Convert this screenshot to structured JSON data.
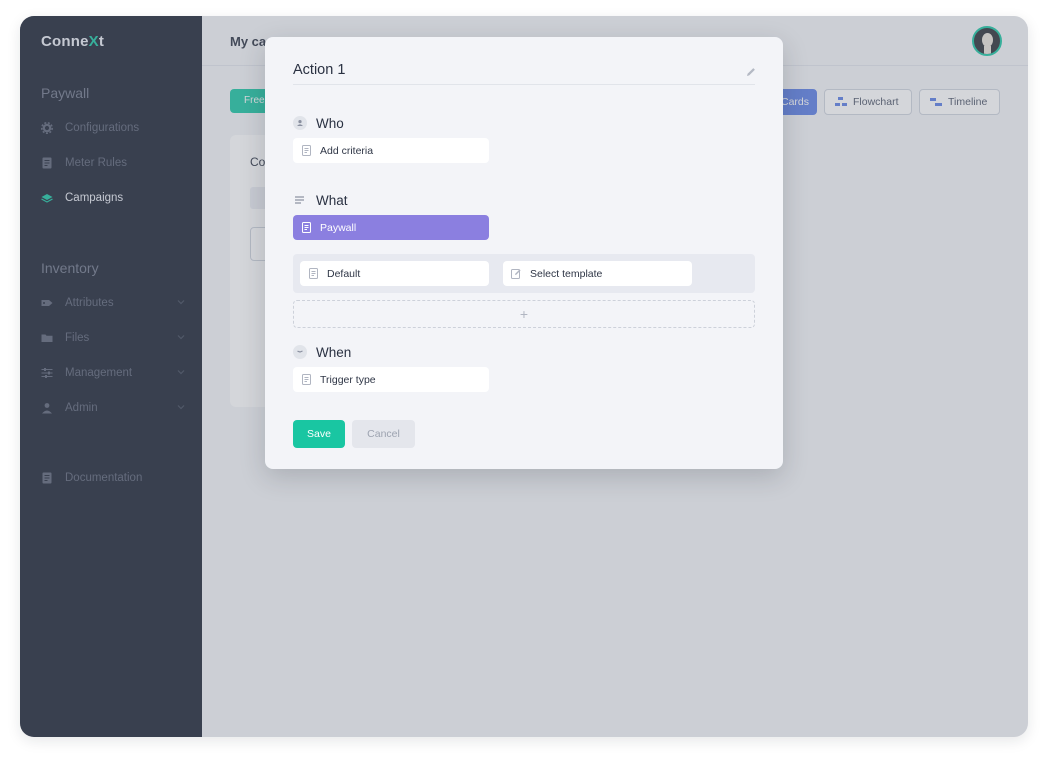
{
  "sidebar": {
    "brand_prefix": "Conne",
    "brand_accent": "X",
    "brand_suffix": "t",
    "sections": [
      {
        "title": "Paywall",
        "items": [
          {
            "label": "Configurations",
            "icon": "gear-icon"
          },
          {
            "label": "Meter Rules",
            "icon": "document-icon"
          },
          {
            "label": "Campaigns",
            "icon": "layers-icon",
            "active": true
          }
        ]
      },
      {
        "title": "Inventory",
        "items": [
          {
            "label": "Attributes",
            "icon": "tag-icon",
            "expandable": true
          },
          {
            "label": "Files",
            "icon": "folder-icon",
            "expandable": true
          },
          {
            "label": "Management",
            "icon": "sliders-icon",
            "expandable": true
          },
          {
            "label": "Admin",
            "icon": "user-icon",
            "expandable": true
          }
        ]
      }
    ],
    "footer_item": {
      "label": "Documentation",
      "icon": "document-icon"
    }
  },
  "main": {
    "title": "My ca",
    "free_button": "Free",
    "view_buttons": [
      {
        "label": "Cards",
        "active": true
      },
      {
        "label": "Flowchart",
        "icon": "flowchart-icon"
      },
      {
        "label": "Timeline",
        "icon": "timeline-icon"
      }
    ],
    "card_heading": "Co"
  },
  "modal": {
    "title": "Action 1",
    "who": {
      "label": "Who",
      "field": "Add criteria"
    },
    "what": {
      "label": "What",
      "selected": "Paywall",
      "template_default": "Default",
      "template_select": "Select template",
      "add_symbol": "+"
    },
    "when": {
      "label": "When",
      "field": "Trigger type"
    },
    "save_label": "Save",
    "cancel_label": "Cancel"
  },
  "colors": {
    "accent_green": "#19c6a2",
    "accent_purple": "#8b7fe0",
    "accent_blue": "#5b7ee5",
    "sidebar_bg": "#1b2233"
  }
}
